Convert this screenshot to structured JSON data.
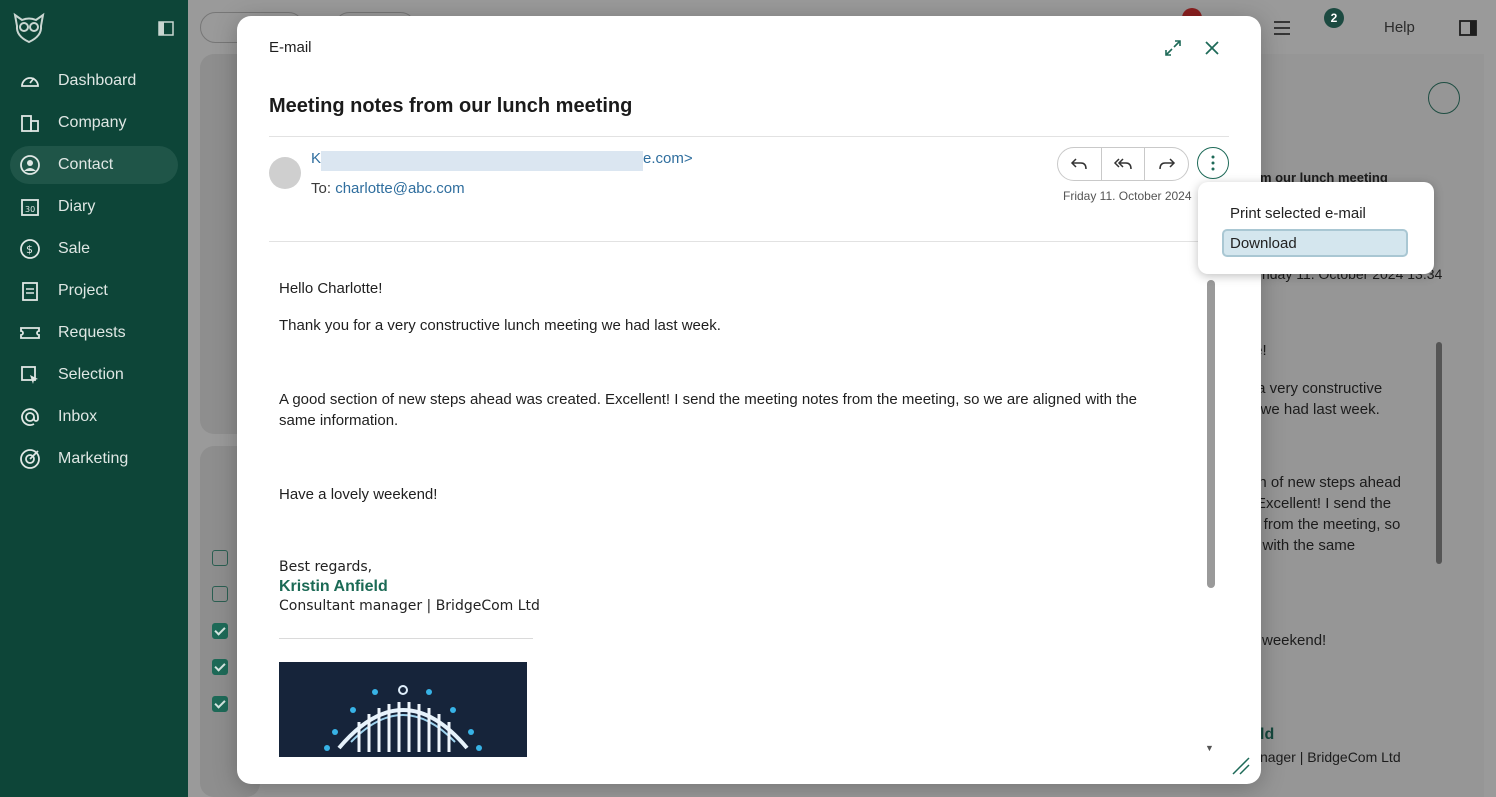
{
  "sidebar": {
    "items": [
      {
        "label": "Dashboard",
        "icon": "gauge-icon"
      },
      {
        "label": "Company",
        "icon": "building-icon"
      },
      {
        "label": "Contact",
        "icon": "person-circle-icon",
        "active": true
      },
      {
        "label": "Diary",
        "icon": "calendar-icon"
      },
      {
        "label": "Sale",
        "icon": "dollar-circle-icon"
      },
      {
        "label": "Project",
        "icon": "clipboard-icon"
      },
      {
        "label": "Requests",
        "icon": "ticket-icon"
      },
      {
        "label": "Selection",
        "icon": "selection-icon"
      },
      {
        "label": "Inbox",
        "icon": "at-icon"
      },
      {
        "label": "Marketing",
        "icon": "target-icon"
      }
    ],
    "calendar_number": "30"
  },
  "topbar": {
    "help_label": "Help",
    "notifications_count": "2"
  },
  "background_panel": {
    "subject_fragment": "om our lunch meeting",
    "date_fragment": "riday 11. October 2024 13:34",
    "body_fragments": [
      "te!",
      "r a very constructive",
      "g we had last week.",
      "on of new steps ahead",
      "Excellent! I send the",
      "s from the meeting, so",
      "d with the same",
      "weekend!"
    ],
    "sig_name_fragment": "ld",
    "sig_role_fragment": "nager | BridgeCom Ltd"
  },
  "modal": {
    "title": "E-mail",
    "subject": "Meeting notes from our lunch meeting",
    "from_start": "K",
    "from_end": "e.com>",
    "to_label": "To:",
    "to_address": "charlotte@abc.com",
    "date": "Friday 11. October 2024",
    "body": {
      "greeting": "Hello Charlotte!",
      "para1": "Thank you for a very constructive lunch meeting we had last week.",
      "para2_line1": "A good section of new steps ahead was created. Excellent! I send the meeting notes from the meeting, so we are aligned with the",
      "para2_line2": "same information.",
      "closing": "Have a lovely weekend!"
    },
    "signature": {
      "regards": "Best regards,",
      "name": "Kristin Anfield",
      "role": "Consultant manager | BridgeCom Ltd"
    }
  },
  "dropdown": {
    "items": [
      {
        "label": "Print selected e-mail",
        "selected": false
      },
      {
        "label": "Download",
        "selected": true
      }
    ]
  },
  "colors": {
    "sidebar_bg": "#0d4538",
    "accent": "#1e6a58",
    "link": "#2f6e9e"
  }
}
